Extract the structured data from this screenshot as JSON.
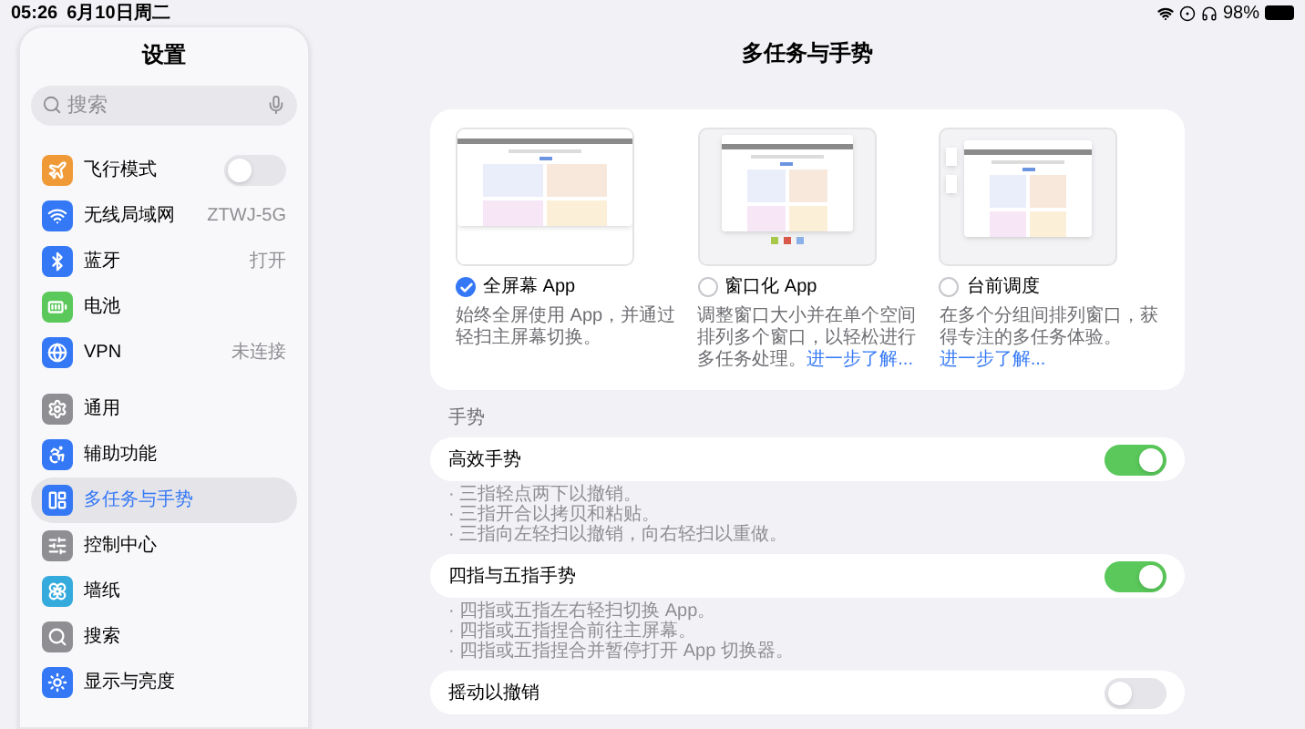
{
  "status_bar": {
    "time": "05:26",
    "date": "6月10日周二",
    "battery": "98%"
  },
  "sidebar": {
    "title": "设置",
    "search": {
      "placeholder": "搜索"
    },
    "groups": [
      [
        {
          "label": "飞行模式",
          "color": "#f09a37",
          "kind": "toggle",
          "on": false,
          "selected": false
        },
        {
          "label": "无线局域网",
          "color": "#3478f6",
          "kind": "value",
          "value": "ZTWJ-5G",
          "selected": false
        },
        {
          "label": "蓝牙",
          "color": "#3478f6",
          "kind": "value",
          "value": "打开",
          "selected": false
        },
        {
          "label": "电池",
          "color": "#5ac85a",
          "kind": "plain",
          "selected": false
        },
        {
          "label": "VPN",
          "color": "#3478f6",
          "kind": "value",
          "value": "未连接",
          "selected": false
        }
      ],
      [
        {
          "label": "通用",
          "color": "#8e8e93",
          "kind": "plain",
          "selected": false
        },
        {
          "label": "辅助功能",
          "color": "#3478f6",
          "kind": "plain",
          "selected": false
        },
        {
          "label": "多任务与手势",
          "color": "#3478f6",
          "kind": "plain",
          "selected": true
        },
        {
          "label": "控制中心",
          "color": "#8e8e93",
          "kind": "plain",
          "selected": false
        },
        {
          "label": "墙纸",
          "color": "#35aadc",
          "kind": "plain",
          "selected": false
        },
        {
          "label": "搜索",
          "color": "#8e8e93",
          "kind": "plain",
          "selected": false
        },
        {
          "label": "显示与亮度",
          "color": "#3478f6",
          "kind": "plain",
          "selected": false
        }
      ]
    ]
  },
  "main": {
    "title": "多任务与手势",
    "modes": [
      {
        "kind": "full",
        "label": "全屏幕 App",
        "selected": true,
        "description": "始终全屏使用 App，并通过轻扫主屏幕切换。"
      },
      {
        "kind": "windowed",
        "label": "窗口化 App",
        "selected": false,
        "description": "调整窗口大小并在单个空间排列多个窗口，以轻松进行多任务处理。",
        "link": "进一步了解..."
      },
      {
        "kind": "stage",
        "label": "台前调度",
        "selected": false,
        "description": "在多个分组间排列窗口，获得专注的多任务体验。",
        "link": "进一步了解..."
      }
    ],
    "section_label": "手势",
    "gestures": [
      {
        "label": "高效手势",
        "on": true,
        "notes": [
          "· 三指轻点两下以撤销。",
          "· 三指开合以拷贝和粘贴。",
          "· 三指向左轻扫以撤销，向右轻扫以重做。"
        ]
      },
      {
        "label": "四指与五指手势",
        "on": true,
        "notes": [
          "· 四指或五指左右轻扫切换 App。",
          "· 四指或五指捏合前往主屏幕。",
          "· 四指或五指捏合并暂停打开 App 切换器。"
        ]
      },
      {
        "label": "摇动以撤销",
        "on": false
      }
    ]
  }
}
